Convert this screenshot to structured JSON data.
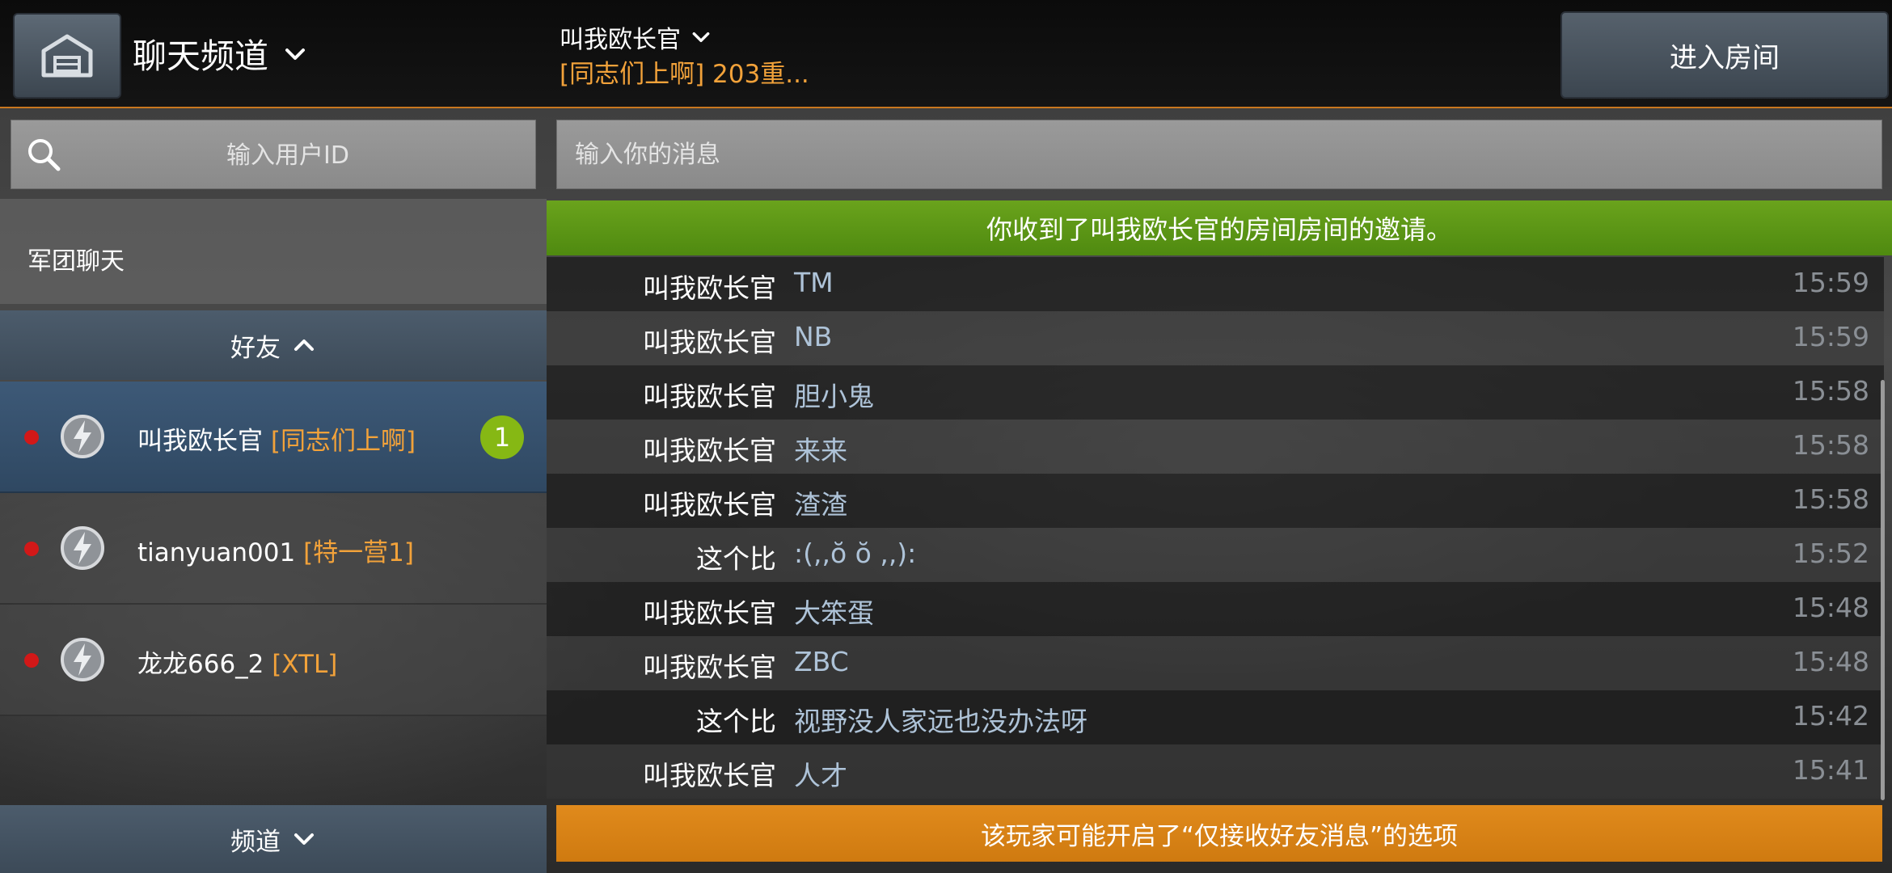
{
  "header": {
    "channel_title": "聊天频道",
    "room_name": "叫我欧长官",
    "room_subtitle": "[同志们上啊] 203重...",
    "enter_room_label": "进入房间"
  },
  "sidebar": {
    "search_placeholder": "输入用户ID",
    "legion_chat_label": "军团聊天",
    "friends_label": "好友",
    "channels_label": "频道",
    "friends": [
      {
        "name": "叫我欧长官",
        "tag": "[同志们上啊]",
        "unread": "1",
        "status_color": "#d21818"
      },
      {
        "name": "tianyuan001",
        "tag": "[特一营1]",
        "status_color": "#d21818"
      },
      {
        "name": "龙龙666_2",
        "tag": "[XTL]",
        "status_color": "#d21818"
      }
    ]
  },
  "chat": {
    "input_placeholder": "输入你的消息",
    "invite_notice": "你收到了叫我欧长官的房间房间的邀请。",
    "messages": [
      {
        "sender": "叫我欧长官",
        "text": "TM",
        "time": "15:59"
      },
      {
        "sender": "叫我欧长官",
        "text": "NB",
        "time": "15:59"
      },
      {
        "sender": "叫我欧长官",
        "text": "胆小鬼",
        "time": "15:58"
      },
      {
        "sender": "叫我欧长官",
        "text": "来来",
        "time": "15:58"
      },
      {
        "sender": "叫我欧长官",
        "text": "渣渣",
        "time": "15:58"
      },
      {
        "sender": "这个比",
        "text": ":(,,ŏ ŏ ,,):",
        "time": "15:52"
      },
      {
        "sender": "叫我欧长官",
        "text": "大笨蛋",
        "time": "15:48"
      },
      {
        "sender": "叫我欧长官",
        "text": "ZBC",
        "time": "15:48"
      },
      {
        "sender": "这个比",
        "text": "视野没人家远也没办法呀",
        "time": "15:42"
      },
      {
        "sender": "叫我欧长官",
        "text": "人才",
        "time": "15:41"
      }
    ],
    "warning_notice": "该玩家可能开启了“仅接收好友消息”的选项"
  },
  "colors": {
    "accent_orange": "#f2a23a",
    "invite_green": "#5f9a16",
    "warning_orange": "#d9821a",
    "unread_badge": "#86b814",
    "offline_dot": "#d21818"
  }
}
